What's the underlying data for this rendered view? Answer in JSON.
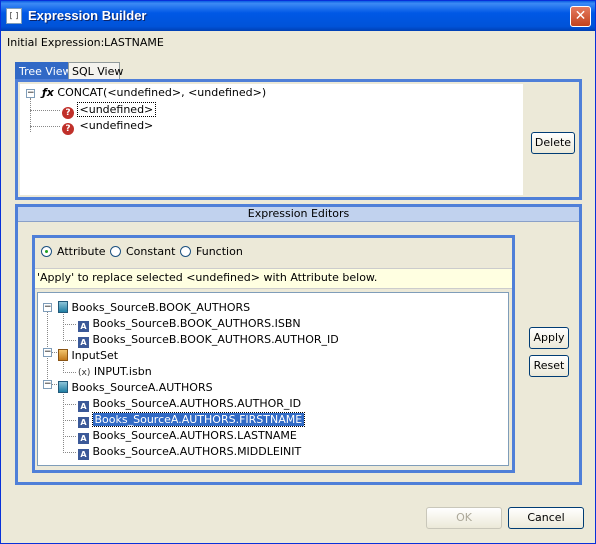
{
  "window": {
    "title": "Expression Builder",
    "close_glyph": "✕",
    "icon_glyph": "[ ]"
  },
  "initial_expression": {
    "label": "Initial Expression:",
    "value": "LASTNAME"
  },
  "tabs": [
    {
      "label": "Tree View",
      "active": true
    },
    {
      "label": "SQL View",
      "active": false
    }
  ],
  "tree_view": {
    "root": {
      "label": "CONCAT(<undefined>, <undefined>)",
      "icon": "function-icon",
      "glyph": "ƒx"
    },
    "children": [
      {
        "label": "<undefined>",
        "selected_outline": true
      },
      {
        "label": "<undefined>",
        "selected_outline": false
      }
    ],
    "delete_label": "Delete"
  },
  "editors": {
    "header": "Expression Editors",
    "radios": [
      {
        "label": "Attribute",
        "checked": true
      },
      {
        "label": "Constant",
        "checked": false
      },
      {
        "label": "Function",
        "checked": false
      }
    ],
    "hint": "'Apply' to replace selected <undefined> with Attribute below.",
    "tree": [
      {
        "label": "Books_SourceB.BOOK_AUTHORS",
        "type": "group"
      },
      {
        "label": "Books_SourceB.BOOK_AUTHORS.ISBN",
        "type": "attr"
      },
      {
        "label": "Books_SourceB.BOOK_AUTHORS.AUTHOR_ID",
        "type": "attr"
      },
      {
        "label": "InputSet",
        "type": "group-orange"
      },
      {
        "label": "INPUT.isbn",
        "type": "var"
      },
      {
        "label": "Books_SourceA.AUTHORS",
        "type": "group"
      },
      {
        "label": "Books_SourceA.AUTHORS.AUTHOR_ID",
        "type": "attr"
      },
      {
        "label": "Books_SourceA.AUTHORS.FIRSTNAME",
        "type": "attr",
        "selected": true
      },
      {
        "label": "Books_SourceA.AUTHORS.LASTNAME",
        "type": "attr"
      },
      {
        "label": "Books_SourceA.AUTHORS.MIDDLEINIT",
        "type": "attr"
      }
    ],
    "apply_label": "Apply",
    "reset_label": "Reset"
  },
  "footer": {
    "ok_label": "OK",
    "cancel_label": "Cancel"
  },
  "glyphs": {
    "expander_minus": "−",
    "question": "?",
    "attr": "A",
    "var": "(x)"
  },
  "colors": {
    "selection": "#316ac5",
    "panel_border": "#4f7fd8",
    "title_bar": "#0058e6"
  }
}
